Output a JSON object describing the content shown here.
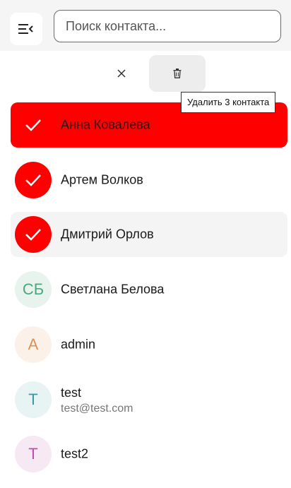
{
  "search": {
    "placeholder": "Поиск контакта..."
  },
  "toolbar": {
    "tooltip": "Удалить 3 контакта"
  },
  "contacts": [
    {
      "initials": "",
      "name": "Анна Ковалева",
      "selected": true
    },
    {
      "initials": "",
      "name": "Артем Волков",
      "selected": true
    },
    {
      "initials": "",
      "name": "Дмитрий Орлов",
      "selected": true
    },
    {
      "initials": "СБ",
      "name": "Светлана Белова",
      "selected": false
    },
    {
      "initials": "A",
      "name": "admin",
      "selected": false
    },
    {
      "initials": "T",
      "name": "test",
      "email": "test@test.com",
      "selected": false
    },
    {
      "initials": "T",
      "name": "test2",
      "selected": false
    }
  ],
  "colors": {
    "accent": "#ff0000",
    "avatar_sb_bg": "#e8f3ee",
    "avatar_sb_fg": "#4aa880",
    "avatar_a_bg": "#fbf1e8",
    "avatar_a_fg": "#d6925a",
    "avatar_t_bg": "#e8f3f4",
    "avatar_t_fg": "#3a9aa0",
    "avatar_t2_bg": "#f6e9f4",
    "avatar_t2_fg": "#c04bb0"
  },
  "icons": {
    "menu": "menu-collapse-icon",
    "close": "close-icon",
    "delete": "trash-icon",
    "check": "check-icon"
  }
}
